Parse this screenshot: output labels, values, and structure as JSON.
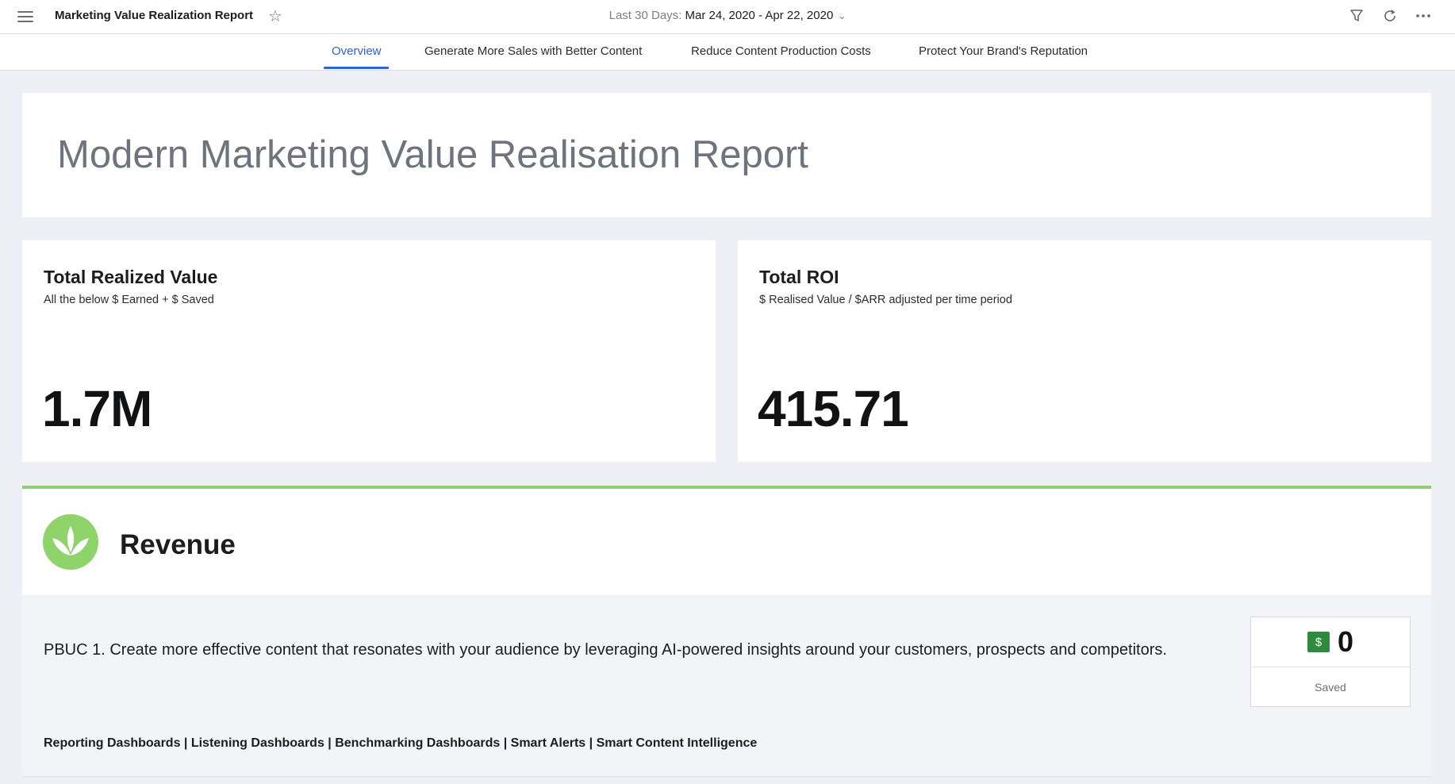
{
  "topbar": {
    "title": "Marketing Value Realization Report",
    "date_prefix": "Last 30 Days: ",
    "date_range": "Mar 24, 2020 - Apr 22, 2020"
  },
  "tabs": [
    {
      "label": "Overview",
      "active": true
    },
    {
      "label": "Generate More Sales with Better Content",
      "active": false
    },
    {
      "label": "Reduce Content Production Costs",
      "active": false
    },
    {
      "label": "Protect Your Brand's Reputation",
      "active": false
    }
  ],
  "hero": {
    "title": "Modern Marketing Value Realisation Report"
  },
  "kpis": [
    {
      "title": "Total Realized Value",
      "subtitle": "All the below $ Earned + $ Saved",
      "value": "1.7M"
    },
    {
      "title": "Total ROI",
      "subtitle": "$ Realised Value / $ARR adjusted per time period",
      "value": "415.71"
    }
  ],
  "revenue": {
    "title": "Revenue",
    "pbuc_text": "PBUC 1. Create more effective content that resonates with your audience by leveraging AI-powered insights around your customers, prospects and competitors.",
    "links": "Reporting Dashboards | Listening Dashboards | Benchmarking Dashboards | Smart Alerts | Smart Content Intelligence",
    "saved": {
      "currency_symbol": "$",
      "value": "0",
      "label": "Saved"
    }
  },
  "colors": {
    "accent_blue": "#2f63d6",
    "revenue_green": "#8fd36b",
    "dollar_green": "#2e8b3d"
  },
  "icons": [
    "menu-icon",
    "star-icon",
    "chevron-down-icon",
    "filter-icon",
    "refresh-icon",
    "more-icon",
    "leaf-logo-icon",
    "dollar-icon"
  ]
}
